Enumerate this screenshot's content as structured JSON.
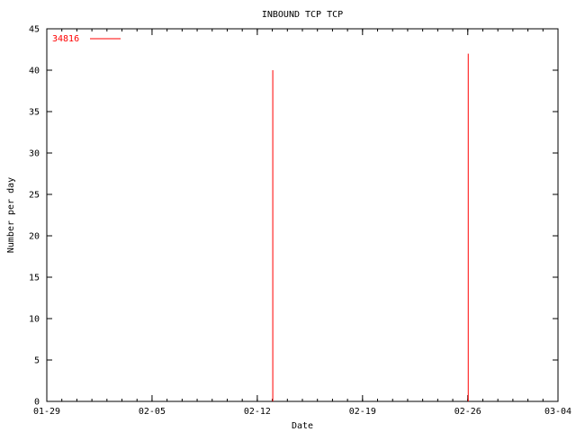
{
  "chart_data": {
    "type": "bar",
    "title": "INBOUND TCP TCP",
    "xlabel": "Date",
    "ylabel": "Number per day",
    "x_ticks": [
      "01-29",
      "02-05",
      "02-12",
      "02-19",
      "02-26",
      "03-04"
    ],
    "xlim": [
      "01-29",
      "03-04"
    ],
    "ylim": [
      0,
      45
    ],
    "y_ticks": [
      0,
      5,
      10,
      15,
      20,
      25,
      30,
      35,
      40,
      45
    ],
    "series": [
      {
        "name": "34816",
        "color": "#ff0000",
        "points": [
          {
            "x": "02-13",
            "y": 40
          },
          {
            "x": "02-26",
            "y": 42
          }
        ]
      }
    ],
    "grid": false,
    "legend": "top-left"
  }
}
